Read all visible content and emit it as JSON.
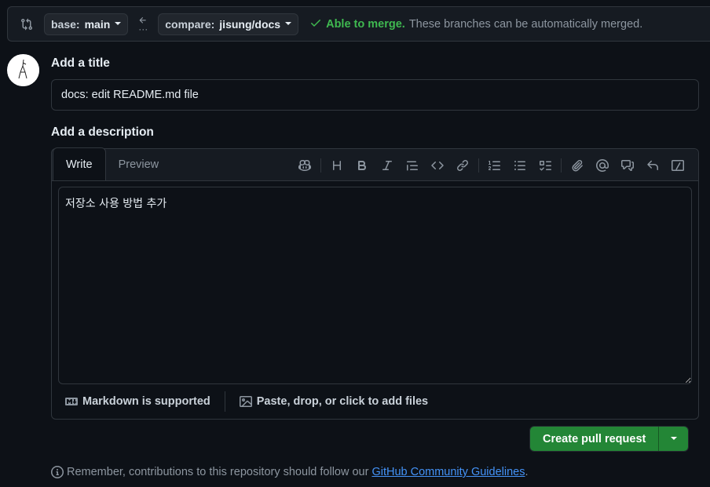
{
  "compare": {
    "base_prefix": "base:",
    "base_branch": "main",
    "compare_prefix": "compare:",
    "compare_branch": "jisung/docs",
    "merge_status": "Able to merge.",
    "merge_description": "These branches can be automatically merged."
  },
  "form": {
    "title_label": "Add a title",
    "title_value": "docs: edit README.md file",
    "description_label": "Add a description",
    "description_value": "저장소 사용 방법 추가",
    "tabs": [
      {
        "label": "Write"
      },
      {
        "label": "Preview"
      }
    ],
    "toolbar_icons": [
      "copilot-icon",
      "heading-icon",
      "bold-icon",
      "italic-icon",
      "quote-icon",
      "code-icon",
      "link-icon",
      "ordered-list-icon",
      "unordered-list-icon",
      "task-list-icon",
      "attach-icon",
      "mention-icon",
      "reference-icon",
      "undo-icon",
      "slash-commands-icon"
    ],
    "markdown_note": "Markdown is supported",
    "files_note": "Paste, drop, or click to add files"
  },
  "actions": {
    "create_label": "Create pull request"
  },
  "note": {
    "text": "Remember, contributions to this repository should follow our",
    "link_text": "GitHub Community Guidelines",
    "suffix": "."
  },
  "colors": {
    "background": "#0d1117",
    "success": "#3fb950",
    "button_green": "#238636",
    "link": "#4493f8"
  }
}
